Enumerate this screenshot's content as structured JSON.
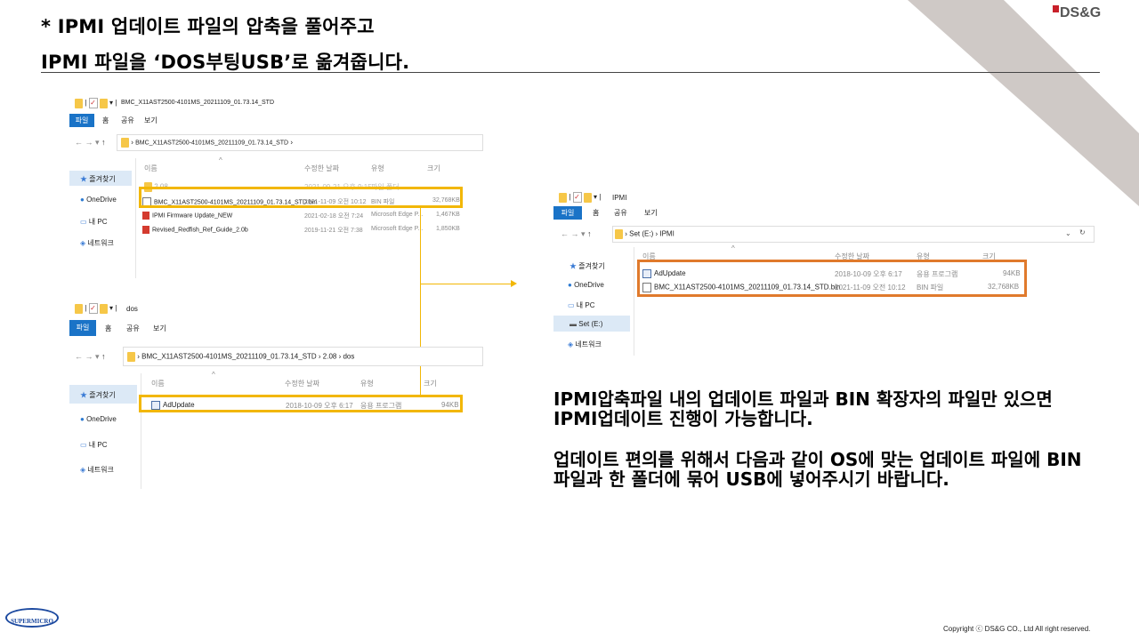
{
  "heading": {
    "line1": "* IPMI 업데이트 파일의 압축을 풀어주고",
    "line2": "IPMI 파일을 ‘DOS부팅USB’로 옮겨줍니다."
  },
  "brand": {
    "logo_text": "DS&G",
    "accent_color": "#c8202a"
  },
  "window1": {
    "title": "BMC_X11AST2500-4101MS_20211109_01.73.14_STD",
    "tabs": [
      "파일",
      "홈",
      "공유",
      "보기"
    ],
    "path": [
      "BMC_X11AST2500-4101MS_20211109_01.73.14_STD"
    ],
    "columns": [
      "이름",
      "수정한 날짜",
      "유형",
      "크기"
    ],
    "sidebar": [
      "즐겨찾기",
      "OneDrive",
      "내 PC",
      "네트워크"
    ],
    "rows": [
      {
        "name": "2.08",
        "date": "2021-09-21 오후 9:15",
        "type": "파일 폴더",
        "size": ""
      },
      {
        "name": "BMC_X11AST2500-4101MS_20211109_01.73.14_STD.bin",
        "date": "2021-11-09 오전 10:12",
        "type": "BIN 파일",
        "size": "32,768KB"
      },
      {
        "name": "IPMI Firmware Update_NEW",
        "date": "2021-02-18 오전 7:24",
        "type": "Microsoft Edge P...",
        "size": "1,467KB"
      },
      {
        "name": "Revised_Redfish_Ref_Guide_2.0b",
        "date": "2019-11-21 오전 7:38",
        "type": "Microsoft Edge P...",
        "size": "1,850KB"
      }
    ]
  },
  "window2": {
    "title": "dos",
    "tabs": [
      "파일",
      "홈",
      "공유",
      "보기"
    ],
    "path": [
      "BMC_X11AST2500-4101MS_20211109_01.73.14_STD",
      "2.08",
      "dos"
    ],
    "columns": [
      "이름",
      "수정한 날짜",
      "유형",
      "크기"
    ],
    "sidebar": [
      "즐겨찾기",
      "OneDrive",
      "내 PC",
      "네트워크"
    ],
    "rows": [
      {
        "name": "AdUpdate",
        "date": "2018-10-09 오후 6:17",
        "type": "응용 프로그램",
        "size": "94KB"
      }
    ]
  },
  "window3": {
    "title": "IPMI",
    "tabs": [
      "파일",
      "홈",
      "공유",
      "보기"
    ],
    "path": [
      "Set (E:)",
      "IPMI"
    ],
    "columns": [
      "이름",
      "수정한 날짜",
      "유형",
      "크기"
    ],
    "sidebar": [
      "즐겨찾기",
      "OneDrive",
      "내 PC",
      "Set (E:)",
      "네트워크"
    ],
    "rows": [
      {
        "name": "AdUpdate",
        "date": "2018-10-09 오후 6:17",
        "type": "응용 프로그램",
        "size": "94KB"
      },
      {
        "name": "BMC_X11AST2500-4101MS_20211109_01.73.14_STD.bin",
        "date": "2021-11-09 오전 10:12",
        "type": "BIN 파일",
        "size": "32,768KB"
      }
    ]
  },
  "description": {
    "para1": "IPMI압축파일 내의 업데이트 파일과 BIN 확장자의 파일만 있으면 IPMI업데이트 진행이 가능합니다.",
    "para2": "업데이트 편의를 위해서 다음과 같이 OS에 맞는 업데이트 파일에 BIN파일과 한 폴더에 묶어 USB에 넣어주시기 바랍니다."
  },
  "footer": {
    "supermicro": "SUPERMICRO",
    "copyright": "Copyright  ⓒ DS&G  CO., Ltd   All  right  reserved."
  }
}
